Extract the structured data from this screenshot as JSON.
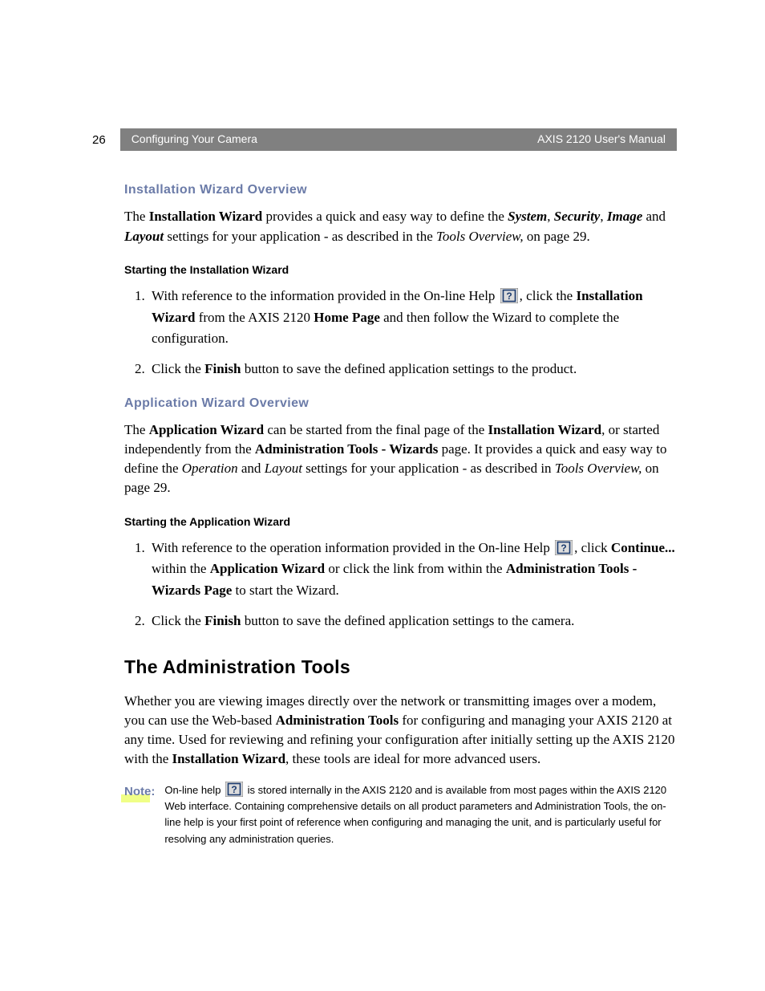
{
  "header": {
    "page_number": "26",
    "section": "Configuring Your Camera",
    "manual": "AXIS 2120 User's Manual"
  },
  "section1": {
    "heading": "Installation Wizard Overview",
    "intro": {
      "t1": "The ",
      "b1": "Installation Wizard",
      "t2": " provides a quick and easy way to define the ",
      "i1": "System",
      "c1": ", ",
      "i2": "Security",
      "c2": ", ",
      "i3": "Image",
      "t3": " and ",
      "i4": "Layout",
      "t4": " settings for your application - as described in the ",
      "i5": "Tools Overview,",
      "t5": " on page 29."
    },
    "sub": "Starting the Installation Wizard",
    "step1": {
      "t1": "With reference to the information provided in the On-line Help ",
      "t2": ", click the ",
      "b1": "Installation Wizard",
      "t3": " from the AXIS 2120 ",
      "b2": "Home Page",
      "t4": " and then follow the Wizard to complete the configuration."
    },
    "step2": {
      "t1": "Click the ",
      "b1": "Finish",
      "t2": " button to save the defined application settings to the product."
    }
  },
  "section2": {
    "heading": "Application Wizard Overview",
    "intro": {
      "t1": "The ",
      "b1": "Application Wizard",
      "t2": " can be started from the final page of the ",
      "b2": "Installation Wizard",
      "t3": ", or started independently from the ",
      "b3": "Administration Tools - Wizards",
      "t4": " page. It provides a quick and easy way to define the ",
      "i1": "Operation",
      "t5": " and ",
      "i2": "Layout",
      "t6": " settings for your application - as described in ",
      "i3": "Tools Overview,",
      "t7": " on page 29."
    },
    "sub": "Starting the Application Wizard",
    "step1": {
      "t1": "With reference to the operation information provided in the On-line Help ",
      "t2": ", click ",
      "b1": "Continue...",
      "t3": " within the ",
      "b2": "Application Wizard",
      "t4": " or click the link from within the ",
      "b3": "Administration Tools - Wizards Page",
      "t5": " to start the Wizard."
    },
    "step2": {
      "t1": "Click the ",
      "b1": "Finish",
      "t2": " button to save the defined application settings to the camera."
    }
  },
  "admin": {
    "heading": "The Administration Tools",
    "p": {
      "t1": "Whether you are viewing images directly over the network or transmitting images over a modem, you can use the Web-based ",
      "b1": "Administration Tools",
      "t2": " for configuring and managing your AXIS 2120 at any time. Used for reviewing and refining your configuration after initially setting up the AXIS 2120 with the ",
      "b2": "Installation Wizard",
      "t3": ", these tools are ideal for more advanced users."
    }
  },
  "note": {
    "label": "Note:",
    "t1": "On-line help ",
    "t2": " is stored internally in the AXIS 2120 and is available from most pages within the AXIS 2120 Web interface. Containing comprehensive details on all product parameters and Administration Tools, the on-line help is your first point of reference when configuring and managing the unit, and is particularly useful for resolving any administration queries."
  }
}
